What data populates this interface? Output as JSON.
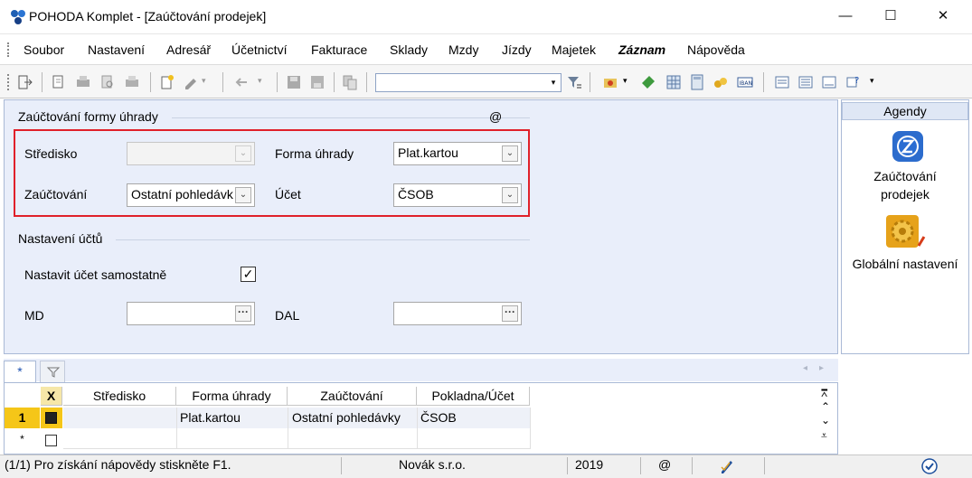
{
  "window": {
    "title": "POHODA Komplet - [Zaúčtování prodejek]",
    "min_glyph": "—",
    "max_glyph": "☐",
    "close_glyph": "✕"
  },
  "menu": {
    "items": [
      {
        "label": "Soubor",
        "bold": false
      },
      {
        "label": "Nastavení",
        "bold": false
      },
      {
        "label": "Adresář",
        "bold": false
      },
      {
        "label": "Účetnictví",
        "bold": false
      },
      {
        "label": "Fakturace",
        "bold": false
      },
      {
        "label": "Sklady",
        "bold": false
      },
      {
        "label": "Mzdy",
        "bold": false
      },
      {
        "label": "Jízdy",
        "bold": false
      },
      {
        "label": "Majetek",
        "bold": false
      },
      {
        "label": "Záznam",
        "bold": true
      },
      {
        "label": "Nápověda",
        "bold": false
      }
    ]
  },
  "toolbar": {
    "search_value": "",
    "combo_arrow": "▾"
  },
  "form": {
    "group1_title": "Zaúčtování formy úhrady",
    "at_sign": "@",
    "stredisko_label": "Středisko",
    "stredisko_value": "",
    "forma_label": "Forma úhrady",
    "forma_value": "Plat.kartou",
    "zauctovani_label": "Zaúčtování",
    "zauctovani_value": "Ostatní pohledávk",
    "ucet_label": "Účet",
    "ucet_value": "ČSOB",
    "group2_title": "Nastavení účtů",
    "nastavit_label": "Nastavit účet samostatně",
    "nastavit_checked": "✓",
    "md_label": "MD",
    "md_value": "",
    "dal_label": "DAL",
    "dal_value": "",
    "dropdown_glyph": "⌄",
    "ellipsis_glyph": "···"
  },
  "agendy": {
    "header": "Agendy",
    "items": [
      {
        "label_line1": "Zaúčtování",
        "label_line2": "prodejek",
        "icon": "zauctovani-icon"
      },
      {
        "label_line1": "Globální nastavení",
        "label_line2": "",
        "icon": "globalni-nastaveni-icon"
      }
    ]
  },
  "table": {
    "tab_new": "*",
    "check_column": "X",
    "columns": [
      "Středisko",
      "Forma úhrady",
      "Zaúčtování",
      "Pokladna/Účet"
    ],
    "rows": [
      {
        "num": "1",
        "stredisko": "",
        "forma": "Plat.kartou",
        "zauctovani": "Ostatní pohledávky",
        "ucet": "ČSOB"
      }
    ],
    "new_row_marker": "*",
    "scroll_glyphs": [
      "⩞",
      "⌃",
      "⌄",
      "⩡"
    ]
  },
  "status": {
    "help": "(1/1) Pro získání nápovědy stiskněte F1.",
    "company": "Novák s.r.o.",
    "year": "2019",
    "at": "@"
  }
}
